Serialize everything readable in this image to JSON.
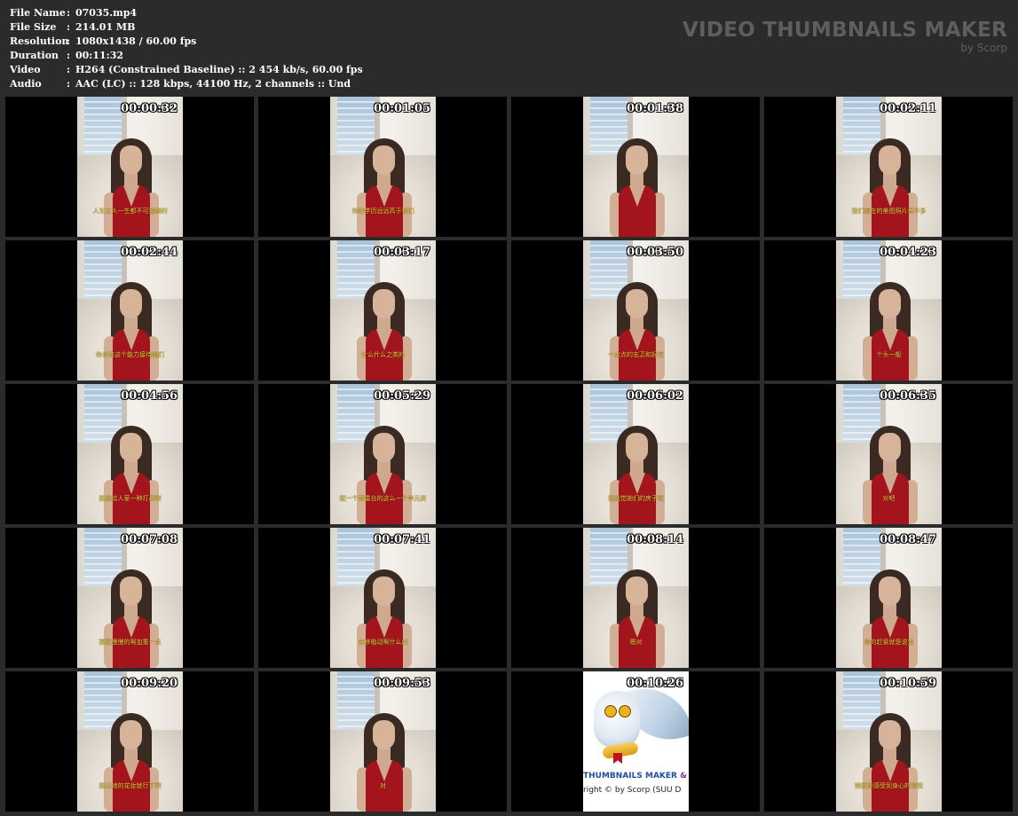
{
  "file_info": [
    {
      "key": "File Name",
      "sep": ":",
      "value": "07035.mp4"
    },
    {
      "key": "File Size",
      "sep": ":",
      "value": "214.01 MB"
    },
    {
      "key": "Resolution",
      "sep": ":",
      "value": "1080x1438 / 60.00 fps"
    },
    {
      "key": "Duration",
      "sep": ":",
      "value": "00:11:32"
    },
    {
      "key": "Video",
      "sep": ":",
      "value": "H264 (Constrained Baseline) :: 2 454 kb/s, 60.00 fps"
    },
    {
      "key": "Audio",
      "sep": ":",
      "value": "AAC (LC) :: 128 kbps, 44100 Hz, 2 channels :: Und"
    }
  ],
  "brand": {
    "title": "VIDEO THUMBNAILS MAKER",
    "subtitle": "by Scorp"
  },
  "colors": {
    "background": "#2b2b2b",
    "thumb_background": "#000000",
    "brand_text": "#5e5e5e",
    "subtitle_text": "#f1d23a",
    "dress": "#a3141d"
  },
  "thumbnails": [
    {
      "time": "00:00:32",
      "subtitle": "人生女人一生都不可逾越的"
    },
    {
      "time": "00:01:05",
      "subtitle": "你的学历远远高于我们"
    },
    {
      "time": "00:01:38",
      "subtitle": ""
    },
    {
      "time": "00:02:11",
      "subtitle": "我们现在的美图照片差不多"
    },
    {
      "time": "00:02:44",
      "subtitle": "你会有这个能力接待她们"
    },
    {
      "time": "00:03:17",
      "subtitle": "什么什么之类的"
    },
    {
      "time": "00:03:50",
      "subtitle": "一点点的志忑和好奇"
    },
    {
      "time": "00:04:23",
      "subtitle": "个头一般"
    },
    {
      "time": "00:04:56",
      "subtitle": "就是给人家一种打击啊"
    },
    {
      "time": "00:05:29",
      "subtitle": "就一个带露台的这么一个单元房"
    },
    {
      "time": "00:06:02",
      "subtitle": "我就觉她们的房子呢"
    },
    {
      "time": "00:06:35",
      "subtitle": "对吧"
    },
    {
      "time": "00:07:08",
      "subtitle": "那就慢慢的啊加重一点"
    },
    {
      "time": "00:07:41",
      "subtitle": "去移植动啊什么的"
    },
    {
      "time": "00:08:14",
      "subtitle": "嗯对"
    },
    {
      "time": "00:08:47",
      "subtitle": "你的赶紧就是说觉"
    },
    {
      "time": "00:09:20",
      "subtitle": "就让她的花妆就行了啊"
    },
    {
      "time": "00:09:53",
      "subtitle": "对"
    },
    {
      "time": "00:10:26",
      "subtitle": "",
      "promo": true,
      "promo_title": "THUMBNAILS MAKER",
      "promo_amp": "& A",
      "promo_copy": "right © by Scorp (SUU D"
    },
    {
      "time": "00:10:59",
      "subtitle": "她就是感受到身心的愉悦"
    }
  ]
}
